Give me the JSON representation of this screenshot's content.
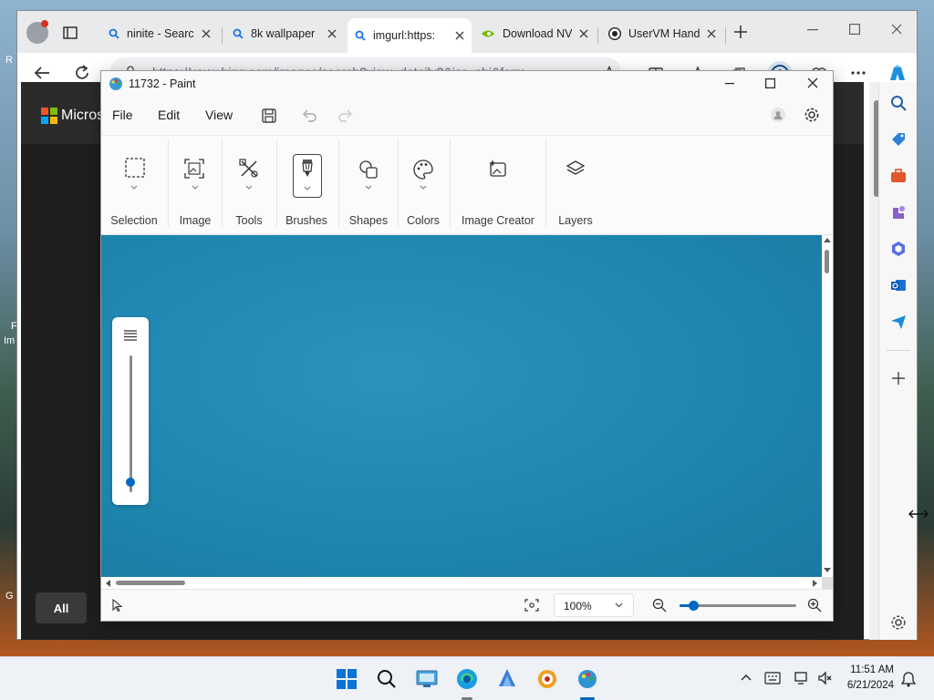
{
  "browser": {
    "tabs": [
      {
        "title": "ninite - Search",
        "icon": "search-icon",
        "active": false
      },
      {
        "title": "8k wallpaper",
        "icon": "search-icon",
        "active": false
      },
      {
        "title": "imgurl:https:",
        "icon": "search-icon",
        "active": true
      },
      {
        "title": "Download NVI",
        "icon": "nvidia-icon",
        "active": false
      },
      {
        "title": "UserVM Hand",
        "icon": "github-icon",
        "active": false
      }
    ],
    "url": "https://www.bing.com/images/search?view=detailv2&iss=sbi&form=...",
    "page_brand": "Micros",
    "page_tab_all": "All"
  },
  "paint": {
    "title": "11732 - Paint",
    "menu": {
      "file": "File",
      "edit": "Edit",
      "view": "View"
    },
    "ribbon": {
      "selection": "Selection",
      "image": "Image",
      "tools": "Tools",
      "brushes": "Brushes",
      "shapes": "Shapes",
      "colors": "Colors",
      "image_creator": "Image Creator",
      "layers": "Layers"
    },
    "zoom": "100%",
    "zoom_slider_fraction": 0.12,
    "canvas_color": "#1d86af"
  },
  "desktop": {
    "side_labels": [
      "R",
      "F",
      "Im",
      "G"
    ]
  },
  "taskbar": {
    "time": "11:51 AM",
    "date": "6/21/2024"
  },
  "colors": {
    "accent": "#0067c0",
    "canvas": "#1d86af"
  }
}
